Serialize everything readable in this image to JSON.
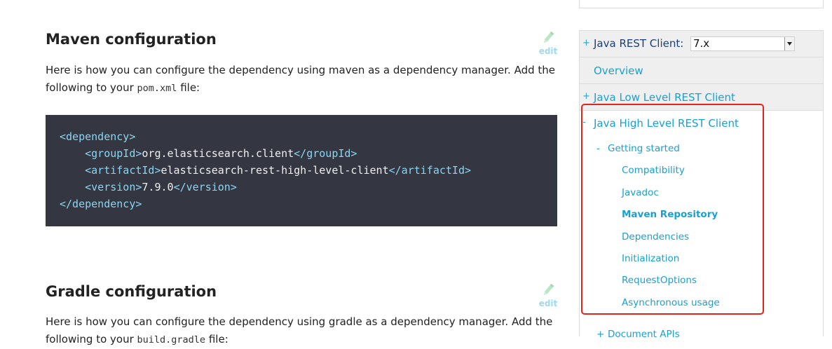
{
  "main": {
    "maven": {
      "title": "Maven configuration",
      "edit_label": "edit",
      "para_prefix": "Here is how you can configure the dependency using maven as a dependency manager. Add the following to your ",
      "para_code": "pom.xml",
      "para_suffix": " file:"
    },
    "code": {
      "open_dependency": "<dependency>",
      "group_open": "<groupId>",
      "group_value": "org.elasticsearch.client",
      "group_close": "</groupId>",
      "artifact_open": "<artifactId>",
      "artifact_value": "elasticsearch-rest-high-level-client",
      "artifact_close": "</artifactId>",
      "version_open": "<version>",
      "version_value": "7.9.0",
      "version_close": "</version>",
      "close_dependency": "</dependency>"
    },
    "gradle": {
      "title": "Gradle configuration",
      "edit_label": "edit",
      "para_prefix": "Here is how you can configure the dependency using gradle as a dependency manager. Add the following to your ",
      "para_code": "build.gradle",
      "para_suffix": " file:"
    }
  },
  "sidebar": {
    "java_rest_client": {
      "prefix": "+",
      "label": "Java REST Client:",
      "version": "7.x"
    },
    "overview": {
      "label": "Overview"
    },
    "low_level": {
      "prefix": "+",
      "label": "Java Low Level REST Client"
    },
    "high_level": {
      "prefix": "-",
      "label": "Java High Level REST Client"
    },
    "getting_started": {
      "prefix": "-",
      "label": "Getting started"
    },
    "items": [
      {
        "label": "Compatibility"
      },
      {
        "label": "Javadoc"
      },
      {
        "label": "Maven Repository",
        "active": true
      },
      {
        "label": "Dependencies"
      },
      {
        "label": "Initialization"
      },
      {
        "label": "RequestOptions"
      },
      {
        "label": "Asynchronous usage"
      }
    ],
    "document_apis": {
      "prefix": "+",
      "label": "Document APIs"
    }
  },
  "colors": {
    "link": "#1aa0cf",
    "code_bg": "#343741",
    "code_tag": "#8bd5f1",
    "highlight_border": "#e1251b"
  },
  "icons": {
    "edit": "pencil-icon",
    "select_arrow": "chevron-down-icon"
  }
}
